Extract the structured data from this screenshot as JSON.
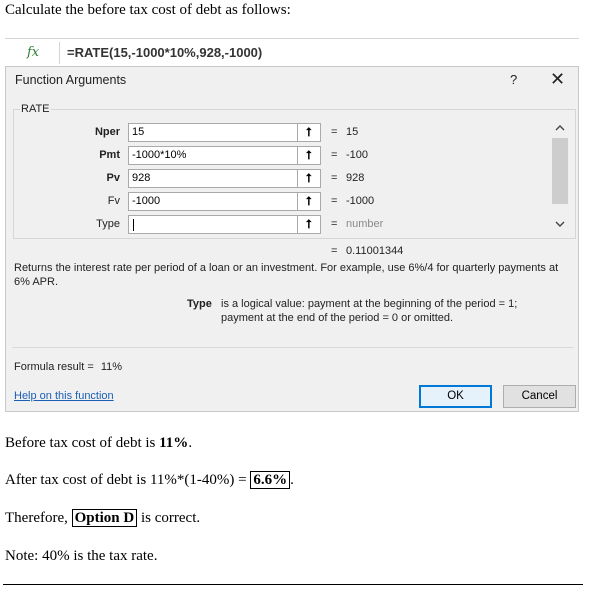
{
  "intro": "Calculate the before tax cost of debt as follows:",
  "formula_bar": {
    "icon": "fx-icon",
    "icon_text": "fx",
    "formula": "=RATE(15,-1000*10%,928,-1000)"
  },
  "dialog": {
    "title": "Function Arguments",
    "help_glyph": "?",
    "close_glyph": "✕",
    "function_name": "RATE",
    "args": [
      {
        "label": "Nper",
        "value": "15",
        "result": "15"
      },
      {
        "label": "Pmt",
        "value": "-1000*10%",
        "result": "-100"
      },
      {
        "label": "Pv",
        "value": "928",
        "result": "928"
      },
      {
        "label": "Fv",
        "value": "-1000",
        "result": "-1000"
      },
      {
        "label": "Type",
        "value": "",
        "result": "number"
      }
    ],
    "ref_glyph": "⭡",
    "eq_glyph": "=",
    "result_eq": "=",
    "result_value": "0.11001344",
    "description": "Returns the interest rate per period of a loan or an investment. For example, use 6%/4 for quarterly payments at 6% APR.",
    "type_label": "Type",
    "type_description": "is a logical value: payment at the beginning of the period = 1; payment at the end of the period = 0 or omitted.",
    "formula_result_label": "Formula result =",
    "formula_result_value": "11%",
    "help_link": "Help on this function",
    "ok": "OK",
    "cancel": "Cancel",
    "scroll_up": "^",
    "scroll_down": "v"
  },
  "answer": {
    "line1_pre": "Before tax cost of debt is ",
    "line1_bold": "11%",
    "line1_post": ".",
    "line2_pre": "After tax cost of debt is 11%*(1-40%) = ",
    "line2_boxed": "6.6%",
    "line2_post": ".",
    "line3_pre": "Therefore, ",
    "line3_boxed": "Option D",
    "line3_post": " is correct.",
    "line4": "Note: 40% is the tax rate."
  }
}
